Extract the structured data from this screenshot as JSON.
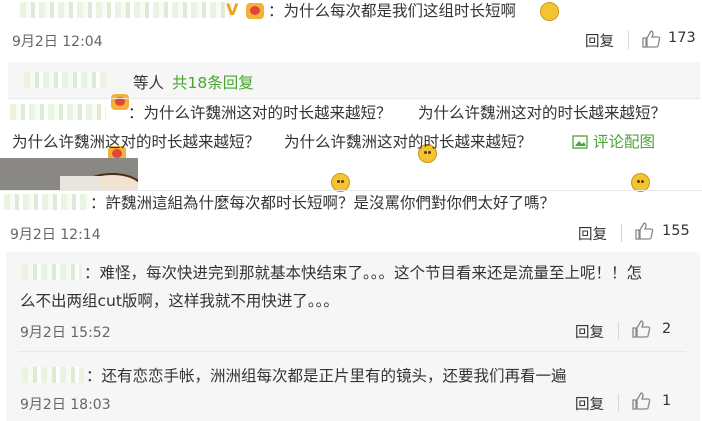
{
  "top_comment": {
    "text": "：为什么每次都是我们这组时长短啊",
    "time": "9月2日 12:04",
    "reply_label": "回复",
    "likes": "173"
  },
  "sub_summary": {
    "suffix": "等人",
    "count_text": "共18条回复"
  },
  "long_comment": {
    "line1_parts": [
      "：为什么许魏洲这对的时长越来越短？",
      "为什么许魏洲这对的时长越来越短？"
    ],
    "line2_parts": [
      "为什么许魏洲这对的时长越来越短？",
      "为什么许魏洲这对的时长越来越短？"
    ],
    "pic_link": "评论配图"
  },
  "main_comment": {
    "text": "：許魏洲這組為什麼每次都时长短啊？是沒罵你們對你們太好了嗎？",
    "time": "9月2日 12:14",
    "reply_label": "回复",
    "likes": "155"
  },
  "reply1": {
    "line1": "：难怪，每次快进完到那就基本快结束了。。。这个节目看来还是流量至上呢！！怎",
    "line2": "么不出两组cut版啊，这样我就不用快进了。。。",
    "time": "9月2日 15:52",
    "reply_label": "回复",
    "likes": "2"
  },
  "reply2": {
    "text": "：还有恋恋手帐，洲洲组每次都是正片里有的镜头，还要我们再看一遍",
    "time": "9月2日 18:03",
    "reply_label": "回复",
    "likes": "1"
  },
  "colors": {
    "link_green": "#4aa534",
    "text": "#333333",
    "muted": "#666666"
  }
}
